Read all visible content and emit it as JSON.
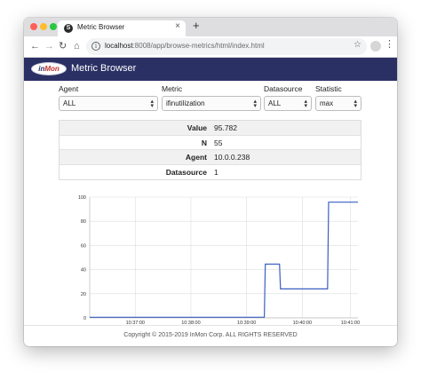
{
  "browser": {
    "tab_title": "Metric Browser",
    "tab_favicon": "S",
    "tab_close": "×",
    "new_tab": "+",
    "url_host": "localhost",
    "url_path": ":8008/app/browse-metrics/html/index.html",
    "icons": {
      "back": "back-arrow-icon",
      "forward": "forward-arrow-icon",
      "reload": "reload-icon",
      "home": "home-icon",
      "info": "info-icon",
      "bookmark": "star-icon",
      "menu": "kebab-menu-icon"
    }
  },
  "header": {
    "logo_in": "in",
    "logo_mon": "Mon",
    "title": "Metric Browser",
    "bar_color": "#2b3064"
  },
  "form": {
    "agent": {
      "label": "Agent",
      "value": "ALL"
    },
    "metric": {
      "label": "Metric",
      "value": "ifinutilization"
    },
    "datasource": {
      "label": "Datasource",
      "value": "ALL"
    },
    "statistic": {
      "label": "Statistic",
      "value": "max"
    }
  },
  "stats": [
    {
      "key": "Value",
      "value": "95.782"
    },
    {
      "key": "N",
      "value": "55"
    },
    {
      "key": "Agent",
      "value": "10.0.0.238"
    },
    {
      "key": "Datasource",
      "value": "1"
    }
  ],
  "chart_data": {
    "type": "line",
    "x_ticks": [
      "10:37:00",
      "10:38:00",
      "10:39:00",
      "10:40:00",
      "10:41:00"
    ],
    "y_ticks": [
      "0",
      "20",
      "40",
      "60",
      "80",
      "100"
    ],
    "ylim": [
      0,
      100
    ],
    "x_minutes_range": [
      0,
      5.3
    ],
    "series": [
      {
        "color": "#3a5fc4",
        "points": [
          [
            0,
            0.5
          ],
          [
            3.45,
            0.5
          ],
          [
            3.47,
            44.5
          ],
          [
            3.75,
            44.5
          ],
          [
            3.77,
            24
          ],
          [
            4.7,
            24
          ],
          [
            4.72,
            95.782
          ],
          [
            5.3,
            95.782
          ]
        ]
      }
    ],
    "grid": true
  },
  "footer": {
    "copyright": "Copyright © 2015-2019 InMon Corp. ALL RIGHTS RESERVED"
  }
}
